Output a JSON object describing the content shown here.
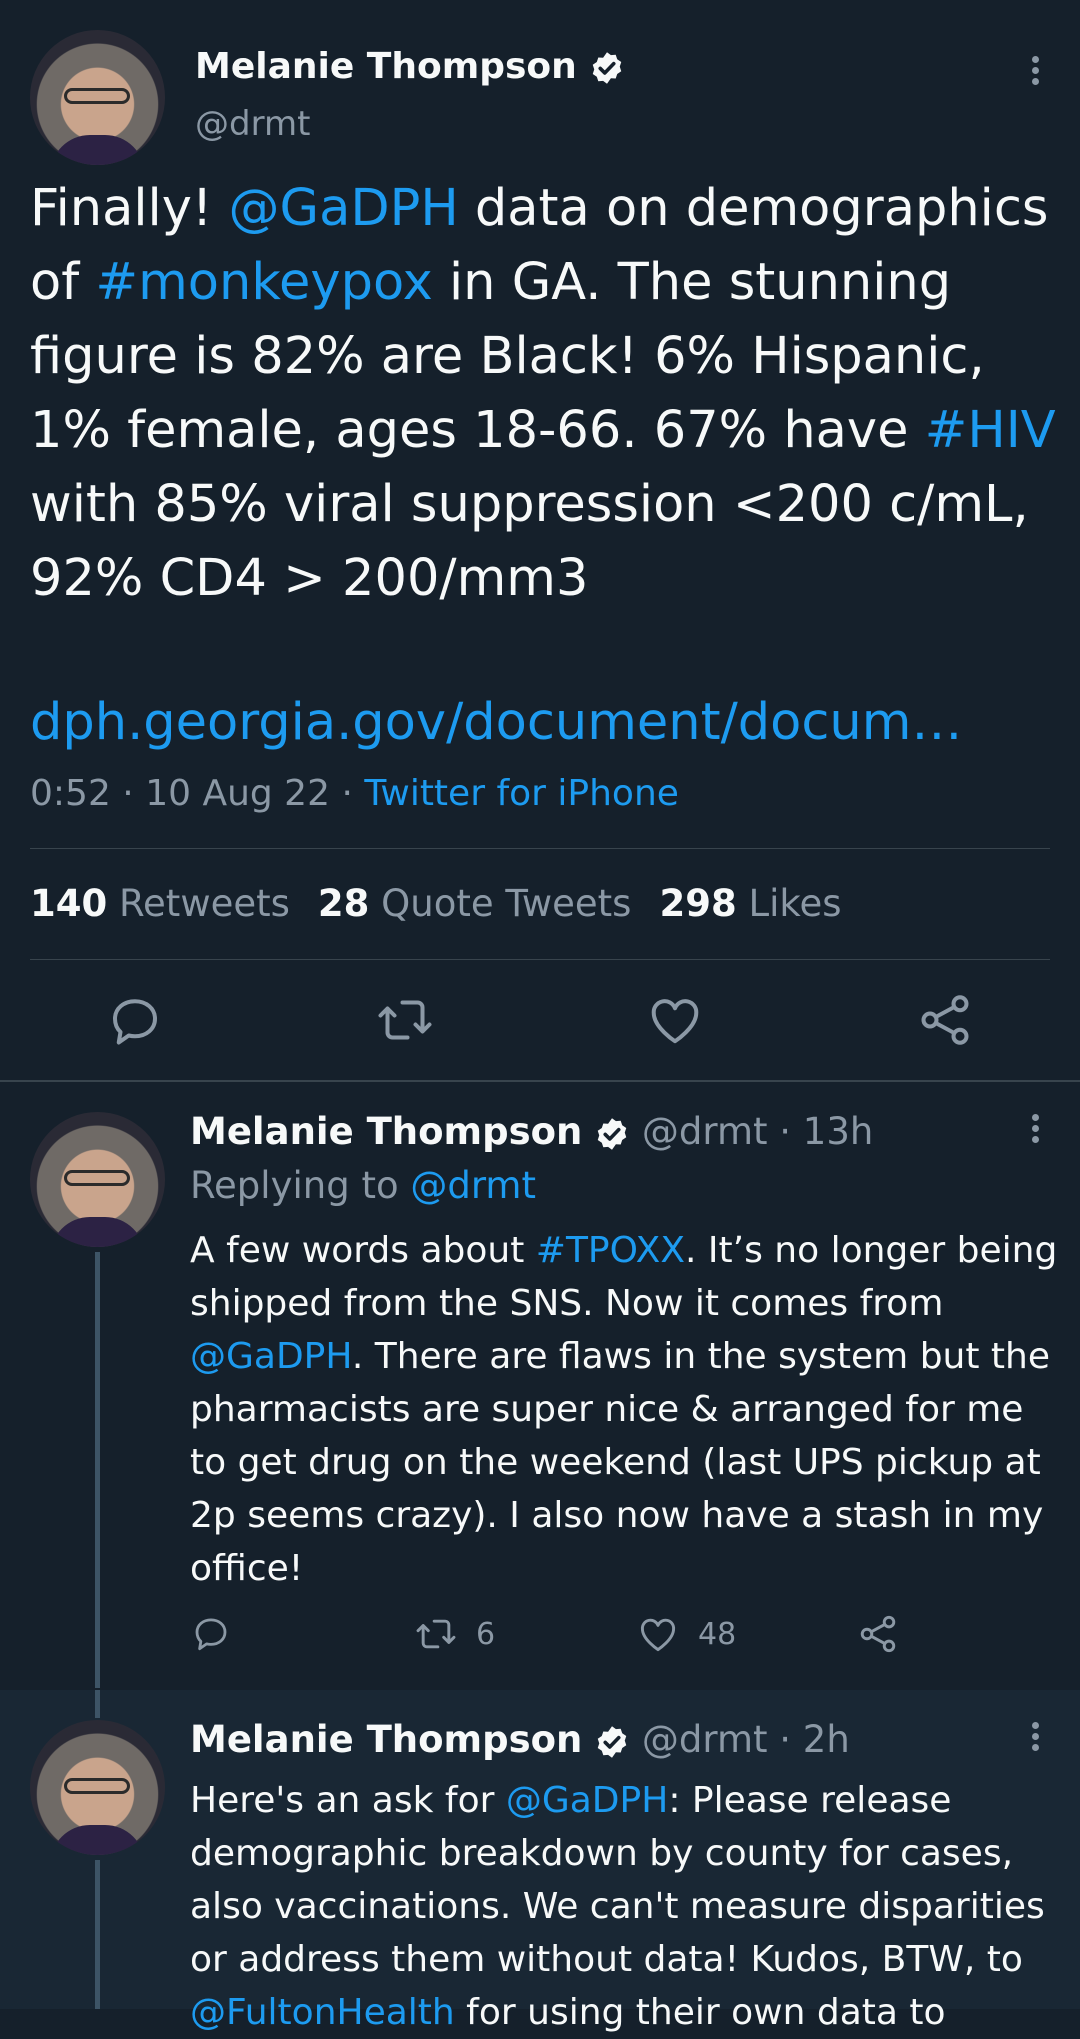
{
  "main_tweet": {
    "display_name": "Melanie Thompson",
    "handle": "@drmt",
    "body_segments": [
      {
        "text": "Finally! ",
        "type": "text"
      },
      {
        "text": "@GaDPH",
        "type": "link"
      },
      {
        "text": " data on demographics of ",
        "type": "text"
      },
      {
        "text": "#monkeypox",
        "type": "link"
      },
      {
        "text": " in GA. The stunning figure is 82% are Black! 6% Hispanic, 1% female, ages 18-66. 67% have ",
        "type": "text"
      },
      {
        "text": "#HIV",
        "type": "link"
      },
      {
        "text": " with 85% viral suppression <200 c/mL, 92% CD4 > 200/mm3",
        "type": "text"
      }
    ],
    "url": "dph.georgia.gov/document/docum…",
    "time": "0:52",
    "date": "10 Aug 22",
    "source": "Twitter for iPhone",
    "meta_sep": " · ",
    "stats": {
      "retweets_count": "140",
      "retweets_label": "Retweets",
      "quotes_count": "28",
      "quotes_label": "Quote Tweets",
      "likes_count": "298",
      "likes_label": "Likes"
    }
  },
  "replies": [
    {
      "display_name": "Melanie Thompson",
      "handle_time": "@drmt · 13h",
      "replying_prefix": "Replying to ",
      "replying_to": "@drmt",
      "body_segments": [
        {
          "text": "A few words about ",
          "type": "text"
        },
        {
          "text": "#TPOXX",
          "type": "link"
        },
        {
          "text": ". It’s no longer being shipped from the SNS. Now it comes from ",
          "type": "text"
        },
        {
          "text": "@GaDPH",
          "type": "link"
        },
        {
          "text": ". There are flaws in the system but the pharmacists are super nice & arranged for me to get drug on the weekend (last UPS pickup at 2p seems crazy). I also now have a stash in my office!",
          "type": "text"
        }
      ],
      "retweet_count": "6",
      "like_count": "48"
    },
    {
      "display_name": "Melanie Thompson",
      "handle_time": "@drmt · 2h",
      "body_segments": [
        {
          "text": "Here's an ask for ",
          "type": "text"
        },
        {
          "text": "@GaDPH",
          "type": "link"
        },
        {
          "text": ": Please release demographic breakdown by county for cases, also vaccinations. We can't measure disparities or address them without data! Kudos, BTW, to ",
          "type": "text"
        },
        {
          "text": "@FultonHealth",
          "type": "link"
        },
        {
          "text": " for using their own data to",
          "type": "text"
        }
      ]
    }
  ],
  "icons": {
    "reply": "speech-bubble-icon",
    "retweet": "retweet-arrows-icon",
    "like": "heart-icon",
    "share": "share-icon",
    "more": "vertical-dots-icon",
    "verified": "verified-badge-icon"
  },
  "colors": {
    "background": "#15202b",
    "text": "#f7f9f9",
    "link": "#1d9bf0",
    "muted": "#8b98a5",
    "divider": "#38444d"
  }
}
